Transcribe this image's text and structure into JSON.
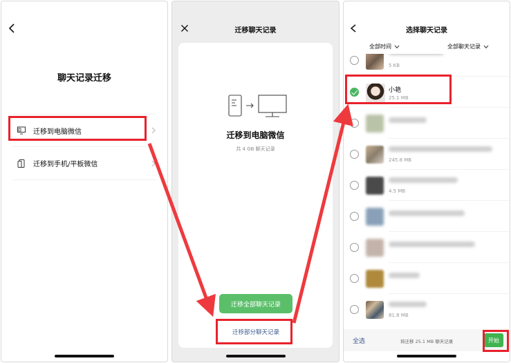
{
  "panel1": {
    "title": "聊天记录迁移",
    "options": [
      {
        "label": "迁移到电脑微信",
        "icon": "computer-icon"
      },
      {
        "label": "迁移到手机/平板微信",
        "icon": "phone-icon"
      }
    ]
  },
  "panel2": {
    "title": "迁移聊天记录",
    "card_title": "迁移到电脑微信",
    "card_sub": "共 4 GB 聊天记录",
    "btn_all": "迁移全部聊天记录",
    "btn_part": "迁移部分聊天记录"
  },
  "panel3": {
    "title": "选择聊天记录",
    "filter_time": "全部时间",
    "filter_chats": "全部聊天记录",
    "items": [
      {
        "name": "",
        "size": "5 KB",
        "selected": false
      },
      {
        "name": "小艳",
        "size": "25.1 MB",
        "selected": true
      },
      {
        "name": "",
        "size": "",
        "selected": false
      },
      {
        "name": "",
        "size": "245.8 MB",
        "selected": false
      },
      {
        "name": "",
        "size": "4.5 MB",
        "selected": false
      },
      {
        "name": "",
        "size": "",
        "selected": false
      },
      {
        "name": "",
        "size": "",
        "selected": false
      },
      {
        "name": "",
        "size": "",
        "selected": false
      },
      {
        "name": "",
        "size": "81.8 MB",
        "selected": false
      }
    ],
    "select_all": "全选",
    "info": "将迁移 25.1 MB 聊天记录",
    "start": "开始"
  },
  "colors": {
    "accent": "#4cb561",
    "annotation": "#e8212b",
    "link": "#3d5c8f"
  }
}
